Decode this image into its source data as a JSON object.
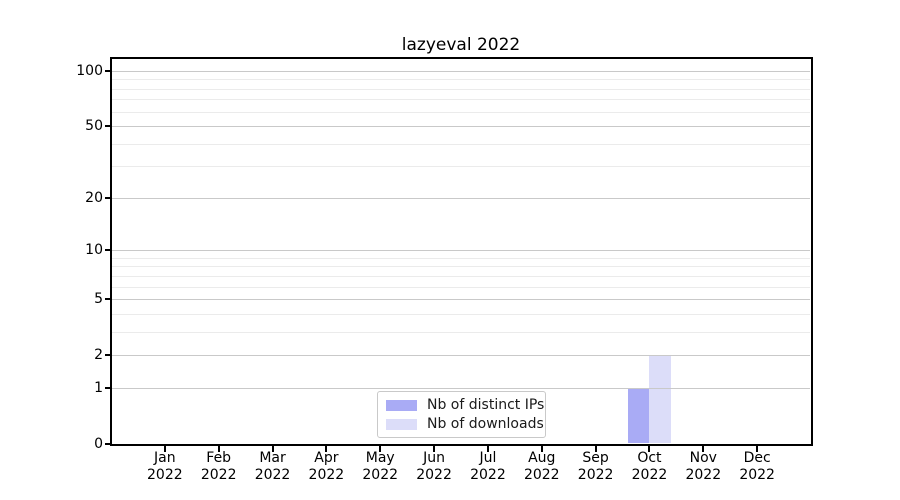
{
  "figure": {
    "title": "lazyeval 2022"
  },
  "chart_data": {
    "type": "bar",
    "title": "lazyeval 2022",
    "categories": [
      "Jan",
      "Feb",
      "Mar",
      "Apr",
      "May",
      "Jun",
      "Jul",
      "Aug",
      "Sep",
      "Oct",
      "Nov",
      "Dec"
    ],
    "year": "2022",
    "series": [
      {
        "name": "Nb of distinct IPs",
        "color": "#a9abf5",
        "values": [
          0,
          0,
          0,
          0,
          0,
          0,
          0,
          0,
          0,
          1,
          0,
          0
        ]
      },
      {
        "name": "Nb of downloads",
        "color": "#dcddf9",
        "values": [
          0,
          0,
          0,
          0,
          0,
          0,
          0,
          0,
          0,
          2,
          0,
          0
        ]
      }
    ],
    "yaxis": {
      "scale": "log1p",
      "ylim": [
        0,
        117
      ],
      "major_ticks": [
        0,
        1,
        2,
        5,
        10,
        20,
        50,
        100
      ],
      "minor_ticks": [
        3,
        4,
        6,
        7,
        8,
        9,
        30,
        40,
        60,
        70,
        80,
        90
      ]
    },
    "xlabel": "",
    "ylabel": "",
    "legend_position": "bottom-center",
    "grid": {
      "on": true,
      "major_color": "#c9c9c9",
      "minor_color": "#ebebeb"
    }
  }
}
